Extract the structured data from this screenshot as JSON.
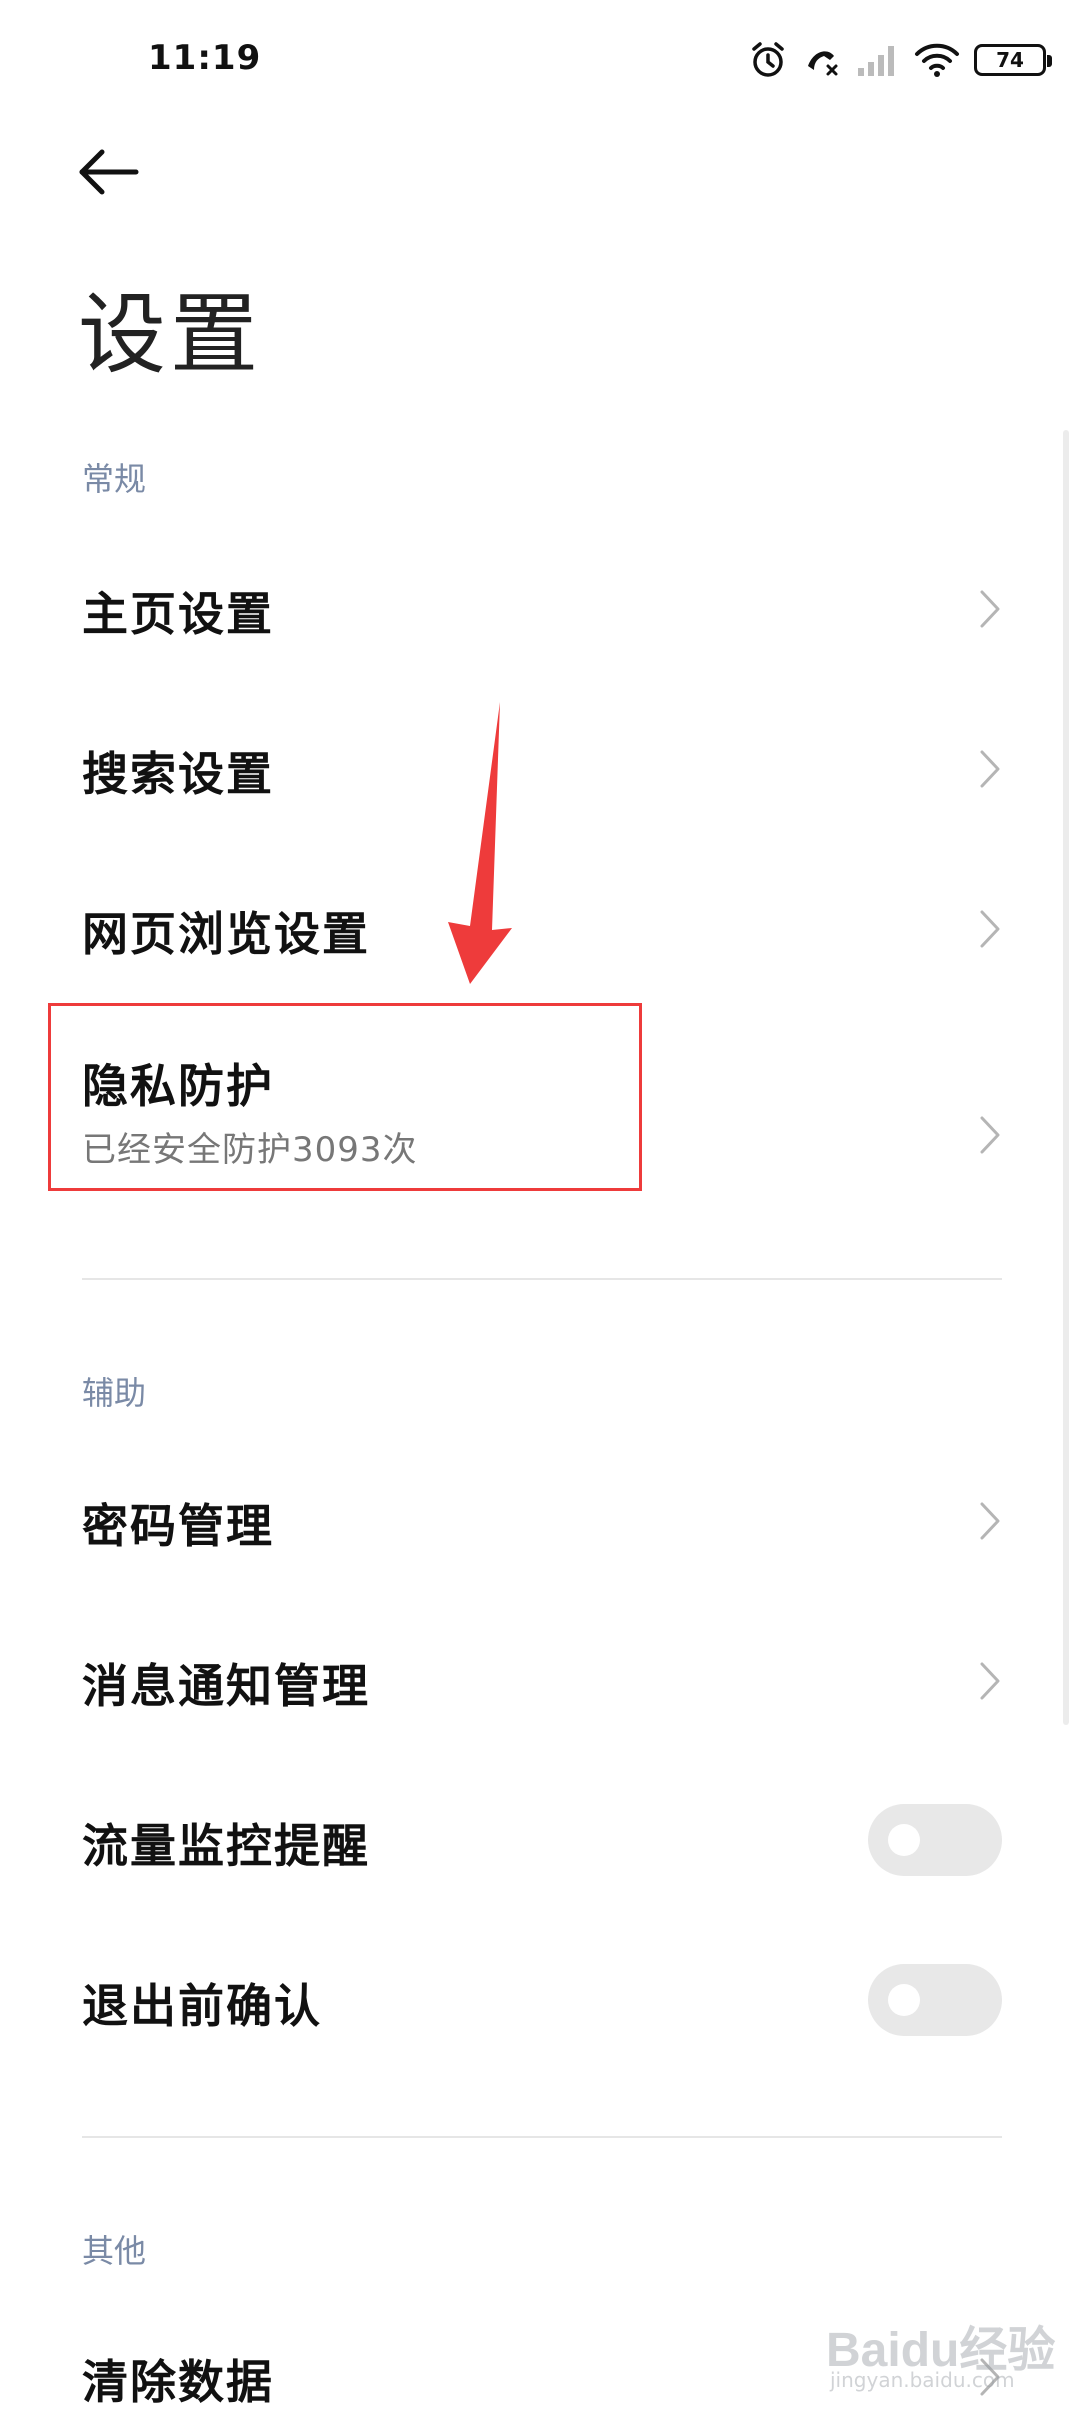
{
  "status_bar": {
    "time": "11:19",
    "battery": "74",
    "icons": [
      "alarm-icon",
      "missed-call-icon",
      "signal-icon",
      "wifi-icon",
      "battery-icon"
    ]
  },
  "header": {
    "back_icon": "back-arrow-icon",
    "title": "设置"
  },
  "sections": {
    "general": {
      "header": "常规",
      "items": [
        {
          "label": "主页设置"
        },
        {
          "label": "搜索设置"
        },
        {
          "label": "网页浏览设置"
        },
        {
          "label": "隐私防护",
          "sub": "已经安全防护3093次"
        }
      ]
    },
    "assist": {
      "header": "辅助",
      "items": [
        {
          "label": "密码管理"
        },
        {
          "label": "消息通知管理"
        },
        {
          "label": "流量监控提醒",
          "toggle": false
        },
        {
          "label": "退出前确认",
          "toggle": false
        }
      ]
    },
    "other": {
      "header": "其他",
      "items": [
        {
          "label": "清除数据"
        }
      ]
    }
  },
  "annotation": {
    "color": "#ee3b3b"
  },
  "watermark": {
    "brand": "Baidu经验",
    "url": "jingyan.baidu.com"
  }
}
